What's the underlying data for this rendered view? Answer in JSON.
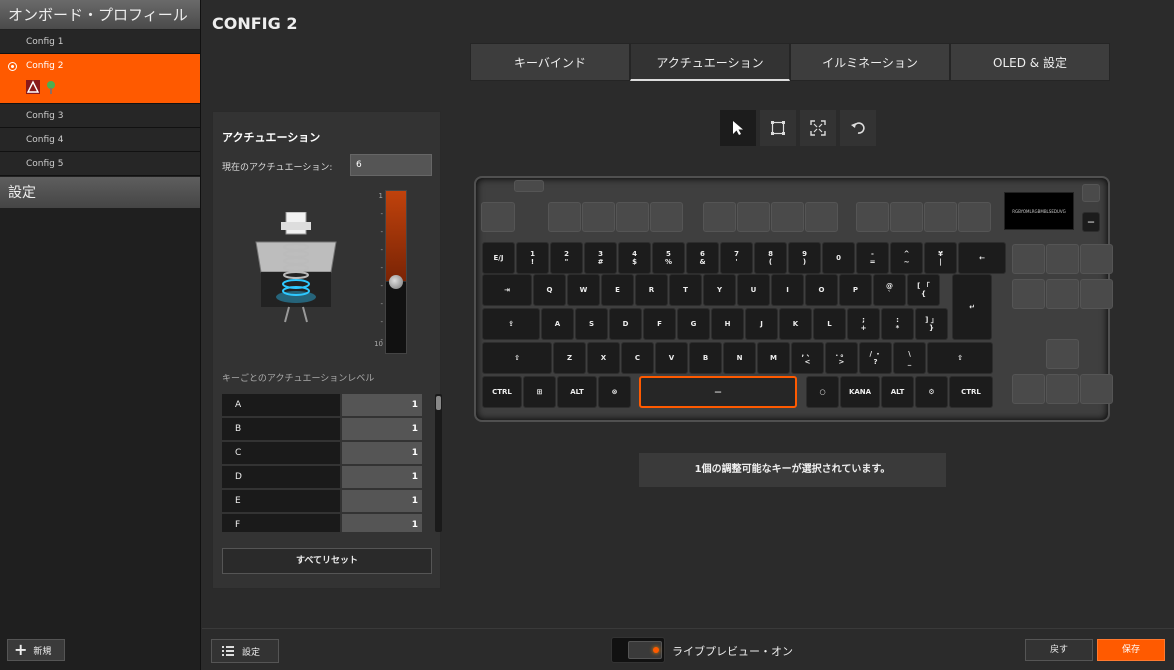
{
  "sidebar": {
    "header": "オンボード・プロフィール",
    "profiles": [
      {
        "label": "Config 1",
        "active": false
      },
      {
        "label": "Config 2",
        "active": true
      },
      {
        "label": "Config 3",
        "active": false
      },
      {
        "label": "Config 4",
        "active": false
      },
      {
        "label": "Config 5",
        "active": false
      }
    ],
    "settings": "設定",
    "new_label": "新規"
  },
  "main": {
    "title": "CONFIG 2",
    "tabs": [
      {
        "label": "キーバインド",
        "active": false
      },
      {
        "label": "アクチュエーション",
        "active": true
      },
      {
        "label": "イルミネーション",
        "active": false
      },
      {
        "label": "OLED & 設定",
        "active": false
      }
    ]
  },
  "actuation_panel": {
    "title": "アクチュエーション",
    "current_label": "現在のアクチュエーション:",
    "current_value": "6",
    "scale_min": "1",
    "scale_max": "10",
    "slider_level": 6,
    "per_key_label": "キーごとのアクチュエーションレベル",
    "keys": [
      {
        "key": "A",
        "level": "1"
      },
      {
        "key": "B",
        "level": "1"
      },
      {
        "key": "C",
        "level": "1"
      },
      {
        "key": "D",
        "level": "1"
      },
      {
        "key": "E",
        "level": "1"
      },
      {
        "key": "F",
        "level": "1"
      }
    ],
    "reset_label": "すべてリセット"
  },
  "toolbar": {
    "tools": [
      "pointer-icon",
      "select-box-icon",
      "fullscreen-icon",
      "undo-icon"
    ]
  },
  "keyboard": {
    "oled_text": "RGBYOMLRGBMBLSEDUVG",
    "row1": [
      {
        "t": "E/J"
      },
      {
        "t": "1\n!"
      },
      {
        "t": "2\n\""
      },
      {
        "t": "3\n#"
      },
      {
        "t": "4\n$"
      },
      {
        "t": "5\n%"
      },
      {
        "t": "6\n&"
      },
      {
        "t": "7\n'"
      },
      {
        "t": "8\n("
      },
      {
        "t": "9\n)"
      },
      {
        "t": "0"
      },
      {
        "t": "-\n="
      },
      {
        "t": "^\n~"
      },
      {
        "t": "¥\n|"
      },
      {
        "t": "←"
      }
    ],
    "row2": [
      {
        "t": "⇥"
      },
      {
        "t": "Q"
      },
      {
        "t": "W"
      },
      {
        "t": "E"
      },
      {
        "t": "R"
      },
      {
        "t": "T"
      },
      {
        "t": "Y"
      },
      {
        "t": "U"
      },
      {
        "t": "I"
      },
      {
        "t": "O"
      },
      {
        "t": "P"
      },
      {
        "t": "@\n`"
      },
      {
        "t": "[ 「\n{"
      }
    ],
    "row3": [
      {
        "t": "⇪"
      },
      {
        "t": "A"
      },
      {
        "t": "S"
      },
      {
        "t": "D"
      },
      {
        "t": "F"
      },
      {
        "t": "G"
      },
      {
        "t": "H"
      },
      {
        "t": "J"
      },
      {
        "t": "K"
      },
      {
        "t": "L"
      },
      {
        "t": ";\n+"
      },
      {
        "t": ":\n*"
      },
      {
        "t": "] 」\n}"
      }
    ],
    "row4": [
      {
        "t": "⇧"
      },
      {
        "t": "Z"
      },
      {
        "t": "X"
      },
      {
        "t": "C"
      },
      {
        "t": "V"
      },
      {
        "t": "B"
      },
      {
        "t": "N"
      },
      {
        "t": "M"
      },
      {
        "t": ", 、\n<"
      },
      {
        "t": ". 。\n>"
      },
      {
        "t": "/ ・\n?"
      },
      {
        "t": "\\\n_"
      },
      {
        "t": "⇧"
      }
    ],
    "row5": [
      {
        "t": "CTRL"
      },
      {
        "t": "⊞"
      },
      {
        "t": "ALT"
      },
      {
        "t": "⊗"
      },
      {
        "t": "—"
      },
      {
        "t": "○"
      },
      {
        "t": "KANA"
      },
      {
        "t": "ALT"
      },
      {
        "t": "⚙"
      },
      {
        "t": "CTRL"
      }
    ],
    "enter": "↵"
  },
  "status": "1個の調整可能なキーが選択されています。",
  "bottom": {
    "settings_label": "設定",
    "live_preview_label": "ライブプレビュー・オン",
    "back_label": "戻す",
    "save_label": "保存"
  },
  "colors": {
    "accent": "#ff5a00",
    "bg": "#2b2b2b",
    "panel": "#333333"
  }
}
